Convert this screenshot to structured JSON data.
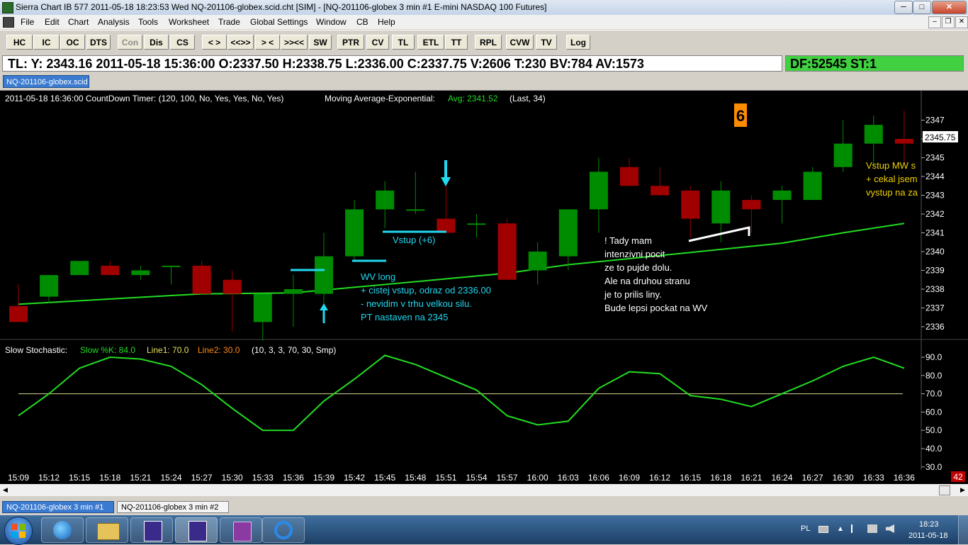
{
  "window": {
    "title": "Sierra Chart IB 577  2011-05-18  18:23:53  Wed   NQ-201106-globex.scid.cht [SIM] - [NQ-201106-globex  3 min   #1  E-mini NASDAQ 100 Futures]"
  },
  "menu": [
    "File",
    "Edit",
    "Chart",
    "Analysis",
    "Tools",
    "Worksheet",
    "Trade",
    "Global Settings",
    "Window",
    "CB",
    "Help"
  ],
  "toolbar": [
    "HC",
    "IC",
    "OC",
    "DTS",
    "Con",
    "Dis",
    "CS",
    "< >",
    "<<>>",
    "> <",
    ">><<",
    "SW",
    "PTR",
    "CV",
    "TL",
    "ETL",
    "TT",
    "RPL",
    "CVW",
    "TV",
    "Log"
  ],
  "toolbar_disabled": [
    "Con"
  ],
  "infobar": {
    "text": "TL: Y: 2343.16  2011-05-18  15:36:00  O:2337.50  H:2338.75  L:2336.00  C:2337.75  V:2606  T:230  BV:784  AV:1573",
    "df": "DF:52545  ST:1"
  },
  "chart_tab": "NQ-201106-globex.scid",
  "chart_header": {
    "timer": "2011-05-18 16:36:00 CountDown Timer:   (120, 100, No, Yes, Yes, No, Yes)",
    "ma_label": "Moving Average-Exponential:",
    "ma_avg": "Avg: 2341.52",
    "ma_params": "(Last, 34)"
  },
  "orange_badge": "6",
  "price_badge": "2345.75",
  "annotations": {
    "vstup": "Vstup (+6)",
    "wv_long": [
      "WV long",
      "+ cistej vstup, odraz od 2336.00",
      "- nevidim v trhu velkou silu.",
      "PT nastaven na 2345"
    ],
    "tady": [
      "! Tady mam",
      "intenzivni pocit",
      "ze to pujde dolu.",
      "Ale na druhou stranu",
      "je to prilis liny.",
      "Bude lepsi pockat na WV"
    ],
    "vstup_mw": [
      "Vstup MW s",
      "+ cekal jsem",
      "vystup na za"
    ]
  },
  "stochastic_header": {
    "title": "Slow Stochastic:",
    "k": "Slow %K: 84.0",
    "line1": "Line1: 70.0",
    "line2": "Line2: 30.0",
    "params": "(10, 3, 3, 70, 30, Smp)"
  },
  "scale_badge": "42",
  "chartbook_tabs": [
    "NQ-201106-globex  3 min   #1",
    "NQ-201106-globex  3 min   #2"
  ],
  "tray": {
    "lang": "PL",
    "time": "18:23",
    "date": "2011-05-18"
  },
  "colors": {
    "up": "#008c00",
    "down": "#a00000",
    "ma": "#22dd22",
    "stoch": "#22dd22",
    "line70": "#d8d890",
    "annotation_cyan": "#22d8f0",
    "annotation_white": "#ffffff",
    "annotation_yellow": "#f0d000",
    "badge_orange": "#ff8c00",
    "df_green": "#40d040"
  },
  "chart_data": [
    {
      "type": "candlestick",
      "x": [
        "15:09",
        "15:12",
        "15:15",
        "15:18",
        "15:21",
        "15:24",
        "15:27",
        "15:30",
        "15:33",
        "15:36",
        "15:39",
        "15:42",
        "15:45",
        "15:48",
        "15:51",
        "15:54",
        "15:57",
        "16:00",
        "16:03",
        "16:06",
        "16:09",
        "16:12",
        "16:15",
        "16:18",
        "16:21",
        "16:24",
        "16:27",
        "16:30",
        "16:33",
        "16:36"
      ],
      "open": [
        2337.1,
        2337.6,
        2338.75,
        2339.25,
        2338.75,
        2339.25,
        2339.25,
        2338.5,
        2336.25,
        2337.75,
        2337.75,
        2339.75,
        2342.25,
        2342.25,
        2341.75,
        2341.5,
        2341.5,
        2339.0,
        2339.75,
        2342.25,
        2344.5,
        2343.5,
        2343.25,
        2341.5,
        2342.75,
        2342.75,
        2342.75,
        2344.5,
        2345.75,
        2346.0
      ],
      "high": [
        2338.25,
        2338.75,
        2339.25,
        2339.5,
        2339.25,
        2339.25,
        2339.5,
        2339.0,
        2337.75,
        2338.75,
        2341.0,
        2342.75,
        2343.75,
        2344.25,
        2343.5,
        2342.0,
        2341.75,
        2340.5,
        2342.0,
        2345.0,
        2345.0,
        2344.5,
        2343.5,
        2343.75,
        2343.0,
        2343.5,
        2344.5,
        2347.0,
        2347.25,
        2347.5
      ],
      "low": [
        2336.5,
        2337.25,
        2338.75,
        2338.75,
        2338.5,
        2338.25,
        2338.0,
        2335.75,
        2335.25,
        2336.0,
        2336.5,
        2339.5,
        2341.25,
        2342.0,
        2341.0,
        2340.75,
        2338.5,
        2338.25,
        2339.0,
        2341.0,
        2343.5,
        2343.0,
        2340.75,
        2340.5,
        2341.0,
        2341.5,
        2342.75,
        2344.25,
        2344.5,
        2344.75
      ],
      "close": [
        2336.25,
        2338.75,
        2339.5,
        2338.75,
        2339.0,
        2339.25,
        2337.75,
        2337.75,
        2337.75,
        2338.0,
        2339.75,
        2342.25,
        2343.25,
        2342.25,
        2341.0,
        2341.5,
        2338.5,
        2340.0,
        2342.25,
        2344.25,
        2343.5,
        2343.0,
        2341.75,
        2343.25,
        2342.25,
        2343.25,
        2344.25,
        2345.75,
        2346.75,
        2345.75
      ],
      "moving_average": {
        "label": "Moving Average-Exponential",
        "x": [
          "15:09",
          "15:27",
          "15:36",
          "15:57",
          "16:03",
          "16:15",
          "16:24",
          "16:30",
          "16:36"
        ],
        "y": [
          2337.2,
          2337.75,
          2337.8,
          2338.85,
          2339.3,
          2339.95,
          2340.45,
          2341.0,
          2341.5
        ]
      },
      "ylim": [
        2335.5,
        2347.5
      ],
      "yticks": [
        2336,
        2337,
        2338,
        2339,
        2340,
        2341,
        2342,
        2343,
        2344,
        2345,
        2346,
        2347
      ]
    },
    {
      "type": "line",
      "title": "Slow Stochastic",
      "x": [
        "15:09",
        "15:12",
        "15:15",
        "15:18",
        "15:21",
        "15:24",
        "15:27",
        "15:30",
        "15:33",
        "15:36",
        "15:39",
        "15:42",
        "15:45",
        "15:48",
        "15:51",
        "15:54",
        "15:57",
        "16:00",
        "16:03",
        "16:06",
        "16:09",
        "16:12",
        "16:15",
        "16:18",
        "16:21",
        "16:24",
        "16:27",
        "16:30",
        "16:33",
        "16:36"
      ],
      "series": [
        {
          "name": "Slow %K",
          "values": [
            58,
            70,
            84,
            90,
            89,
            85,
            75,
            62,
            50,
            50,
            66,
            78,
            91,
            86,
            79,
            72,
            58,
            53,
            55,
            73,
            82,
            81,
            69,
            67,
            63,
            70,
            77,
            85,
            90,
            84
          ]
        }
      ],
      "line1": 70,
      "line2": 30,
      "ylim": [
        30,
        95
      ],
      "yticks": [
        30,
        40,
        50,
        60,
        70,
        80,
        90
      ]
    }
  ]
}
